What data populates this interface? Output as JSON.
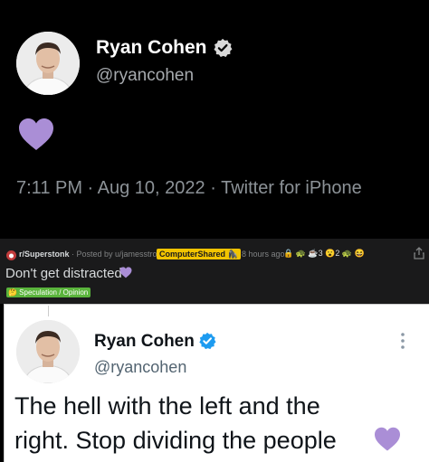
{
  "top_tweet": {
    "name": "Ryan Cohen",
    "handle": "@ryancohen",
    "emoji": "purple-heart",
    "meta": "7:11 PM · Aug 10, 2022 · Twitter for iPhone"
  },
  "reddit_post": {
    "subreddit": "r/Superstonk",
    "posted_by": " · Posted by u/jamesstrogg",
    "user_flair": "ComputerShared 🦍",
    "time_ago": "8 hours ago",
    "award_counts": "🔒 🐢 ☕3 😮2 🐢 😆",
    "title": "Don't get distracted",
    "flair": "🤔 Speculation / Opinion"
  },
  "bottom_tweet": {
    "name": "Ryan Cohen",
    "handle": "@ryancohen",
    "text": "The hell with the left and the right. Stop dividing the people"
  },
  "colors": {
    "verified_blue": "#1d9bf0",
    "heart_purple": "#aa8ed6",
    "reddit_bg": "#1a1a1b",
    "flair_green": "#5ab43c",
    "user_flair_yellow": "#f2c400"
  }
}
